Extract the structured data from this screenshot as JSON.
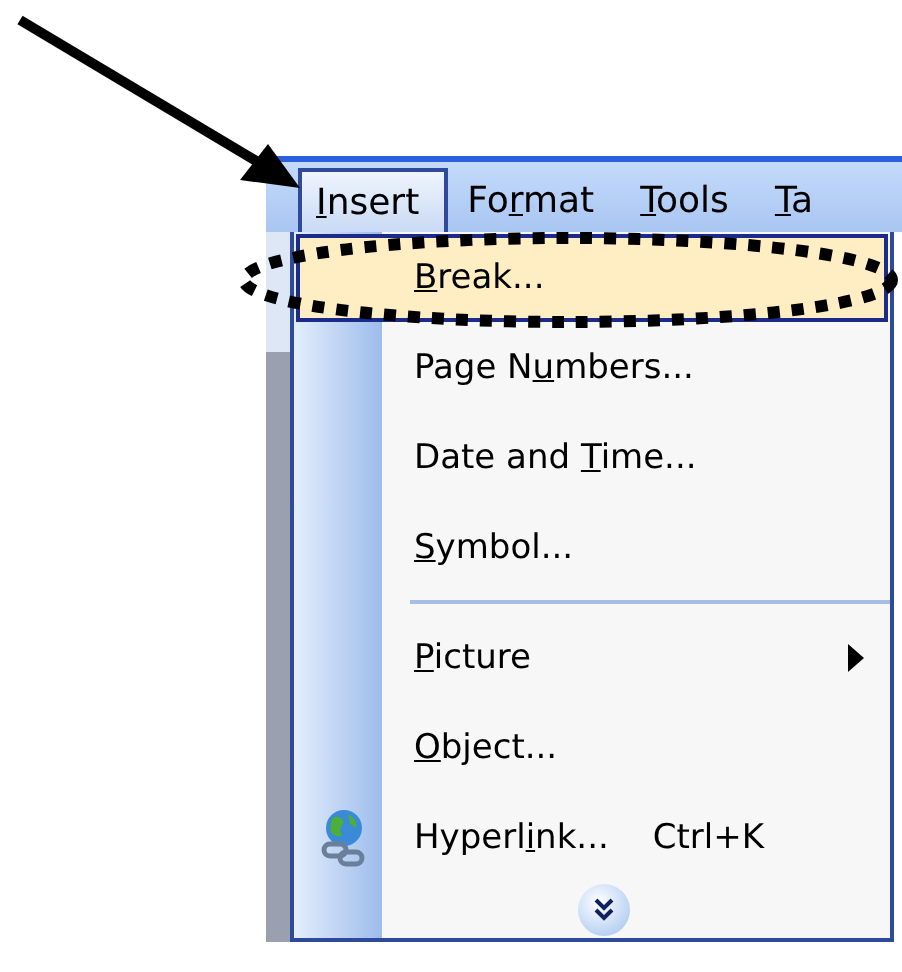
{
  "menu_bar": [
    {
      "key": "I",
      "post": "nsert",
      "selected": true
    },
    {
      "pre": "Fo",
      "key": "r",
      "post": "mat",
      "selected": false
    },
    {
      "key": "T",
      "post": "ools",
      "selected": false
    },
    {
      "key": "T",
      "post": "a",
      "selected": false
    }
  ],
  "menu": [
    {
      "kind": "item",
      "key": "B",
      "post": "reak...",
      "selected": true
    },
    {
      "kind": "item",
      "pre": "Page N",
      "key": "u",
      "post": "mbers...",
      "selected": false
    },
    {
      "kind": "item",
      "pre": "Date and ",
      "key": "T",
      "post": "ime...",
      "selected": false
    },
    {
      "kind": "item",
      "key": "S",
      "post": "ymbol...",
      "selected": false
    },
    {
      "kind": "separator"
    },
    {
      "kind": "item",
      "key": "P",
      "post": "icture",
      "selected": false,
      "submenu": true
    },
    {
      "kind": "item",
      "key": "O",
      "post": "bject...",
      "selected": false
    },
    {
      "kind": "item",
      "pre": "Hyperl",
      "key": "i",
      "post": "nk...",
      "shortcut": "Ctrl+K",
      "selected": false,
      "icon": true
    },
    {
      "kind": "expand"
    }
  ]
}
